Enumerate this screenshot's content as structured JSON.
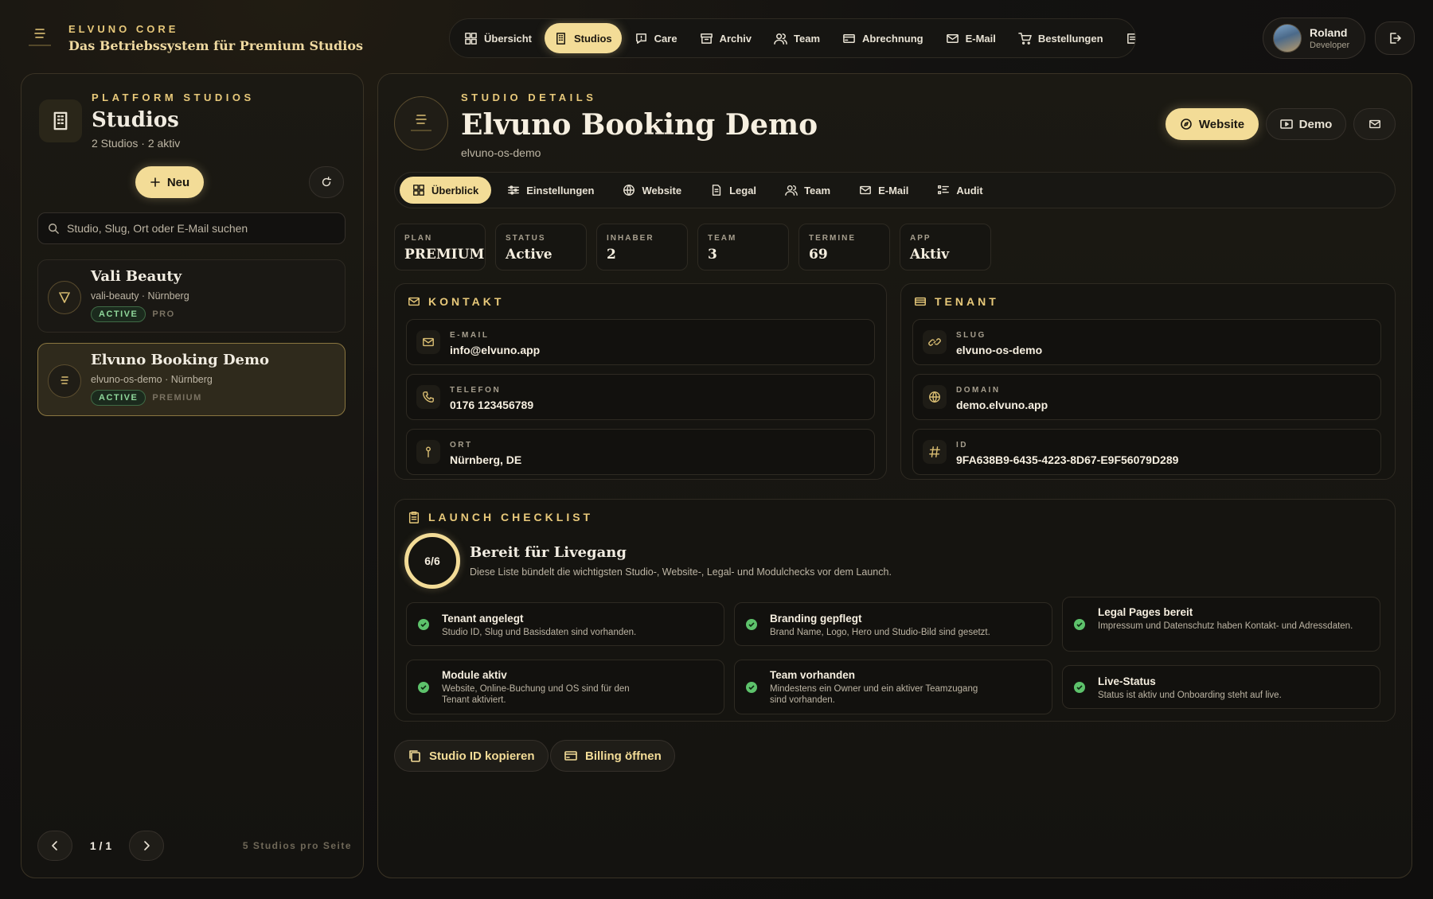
{
  "brand": {
    "kicker": "ELVUNO CORE",
    "subtitle": "Das Betriebssystem für Premium Studios"
  },
  "nav": [
    {
      "label": "Übersicht",
      "icon": "grid-icon",
      "active": false
    },
    {
      "label": "Studios",
      "icon": "building-icon",
      "active": true
    },
    {
      "label": "Care",
      "icon": "chat-icon",
      "active": false
    },
    {
      "label": "Archiv",
      "icon": "archive-icon",
      "active": false
    },
    {
      "label": "Team",
      "icon": "users-icon",
      "active": false
    },
    {
      "label": "Abrechnung",
      "icon": "card-icon",
      "active": false
    },
    {
      "label": "E-Mail",
      "icon": "mail-icon",
      "active": false
    },
    {
      "label": "Bestellungen",
      "icon": "cart-icon",
      "active": false
    }
  ],
  "user": {
    "name": "Roland",
    "role": "Developer"
  },
  "left": {
    "kicker": "PLATFORM STUDIOS",
    "title": "Studios",
    "subtitle": "2 Studios · 2 aktiv",
    "new_label": "Neu",
    "search_placeholder": "Studio, Slug, Ort oder E-Mail suchen",
    "studios": [
      {
        "name": "Vali Beauty",
        "meta": "vali-beauty · Nürnberg",
        "status": "ACTIVE",
        "plan": "PRO",
        "selected": false
      },
      {
        "name": "Elvuno Booking Demo",
        "meta": "elvuno-os-demo · Nürnberg",
        "status": "ACTIVE",
        "plan": "PREMIUM",
        "selected": true
      }
    ],
    "pager": {
      "text": "1 / 1",
      "info": "5 Studios pro Seite"
    }
  },
  "detail": {
    "kicker": "STUDIO DETAILS",
    "title": "Elvuno Booking Demo",
    "slug": "elvuno-os-demo",
    "website_label": "Website",
    "demo_label": "Demo",
    "tabs": [
      {
        "label": "Überblick",
        "icon": "grid-icon",
        "active": true
      },
      {
        "label": "Einstellungen",
        "icon": "sliders-icon",
        "active": false
      },
      {
        "label": "Website",
        "icon": "globe-icon",
        "active": false
      },
      {
        "label": "Legal",
        "icon": "document-icon",
        "active": false
      },
      {
        "label": "Team",
        "icon": "users-icon",
        "active": false
      },
      {
        "label": "E-Mail",
        "icon": "mail-icon",
        "active": false
      },
      {
        "label": "Audit",
        "icon": "list-icon",
        "active": false
      }
    ],
    "stats": [
      {
        "label": "PLAN",
        "value": "PREMIUM"
      },
      {
        "label": "STATUS",
        "value": "Active"
      },
      {
        "label": "INHABER",
        "value": "2"
      },
      {
        "label": "TEAM",
        "value": "3"
      },
      {
        "label": "TERMINE",
        "value": "69"
      },
      {
        "label": "APP",
        "value": "Aktiv"
      }
    ],
    "kontakt": {
      "title": "KONTAKT",
      "fields": [
        {
          "label": "E-MAIL",
          "value": "info@elvuno.app",
          "icon": "mail-icon"
        },
        {
          "label": "TELEFON",
          "value": "0176 123456789",
          "icon": "phone-icon"
        },
        {
          "label": "ORT",
          "value": "Nürnberg, DE",
          "icon": "pin-icon"
        }
      ]
    },
    "tenant": {
      "title": "TENANT",
      "fields": [
        {
          "label": "SLUG",
          "value": "elvuno-os-demo",
          "icon": "link-icon"
        },
        {
          "label": "DOMAIN",
          "value": "demo.elvuno.app",
          "icon": "globe-icon"
        },
        {
          "label": "ID",
          "value": "9FA638B9-6435-4223-8D67-E9F56079D289",
          "icon": "hash-icon"
        }
      ]
    },
    "checklist": {
      "title": "LAUNCH CHECKLIST",
      "progress": "6/6",
      "progress_fraction": 1.0,
      "headline": "Bereit für Livegang",
      "description": "Diese Liste bündelt die wichtigsten Studio-, Website-, Legal- und Modulchecks vor dem Launch.",
      "items": [
        {
          "title": "Tenant angelegt",
          "desc": "Studio ID, Slug und Basisdaten sind vorhanden.",
          "done": true
        },
        {
          "title": "Branding gepflegt",
          "desc": "Brand Name, Logo, Hero und Studio-Bild sind gesetzt.",
          "done": true
        },
        {
          "title": "Legal Pages bereit",
          "desc": "Impressum und Datenschutz haben Kontakt- und Adressdaten.",
          "done": true
        },
        {
          "title": "Module aktiv",
          "desc": "Website, Online-Buchung und OS sind für den Tenant aktiviert.",
          "done": true
        },
        {
          "title": "Team vorhanden",
          "desc": "Mindestens ein Owner und ein aktiver Teamzugang sind vorhanden.",
          "done": true
        },
        {
          "title": "Live-Status",
          "desc": "Status ist aktiv und Onboarding steht auf live.",
          "done": true
        }
      ]
    },
    "actions": {
      "copy_id": "Studio ID kopieren",
      "billing": "Billing öffnen"
    }
  },
  "colors": {
    "accent": "#f3dc97",
    "gold": "#e8c97a",
    "success": "#5dc26b",
    "background": "#131211"
  }
}
